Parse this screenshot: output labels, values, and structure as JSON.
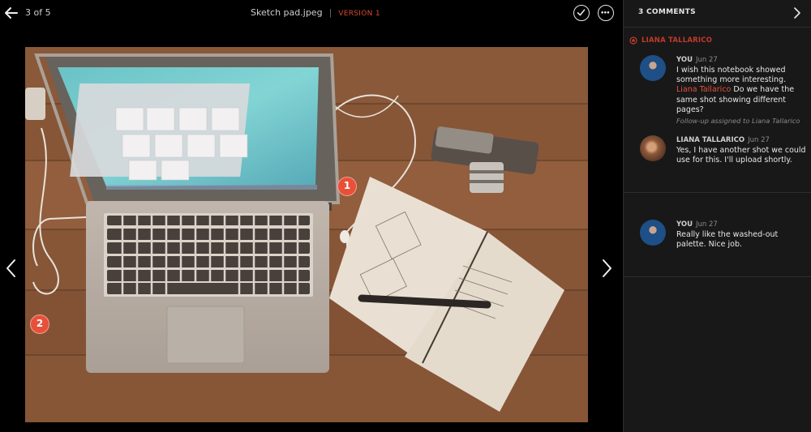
{
  "header": {
    "counter": "3 of 5",
    "filename": "Sketch pad.jpeg",
    "separator": "|",
    "version": "VERSION 1"
  },
  "viewer": {
    "image_description": "Laptop, notebook, pen and camera on wooden desk",
    "pins": [
      {
        "number": "1"
      },
      {
        "number": "2"
      }
    ]
  },
  "sidebar": {
    "title": "3 COMMENTS",
    "thread_label": "LIANA TALLARICO",
    "comments": [
      {
        "author": "YOU",
        "date": "Jun 27",
        "text_before": "I wish this notebook showed something more interesting.",
        "mention": "Liana Tallarico",
        "text_after": "Do we have the same shot showing different pages?",
        "note": "Follow-up assigned to Liana Tallarico"
      },
      {
        "author": "LIANA TALLARICO",
        "date": "Jun 27",
        "text": "Yes, I have another shot we could use for this. I'll upload shortly."
      },
      {
        "author": "YOU",
        "date": "Jun 27",
        "text": "Really like the washed-out palette. Nice job."
      }
    ]
  },
  "colors": {
    "accent": "#d9472f",
    "pin": "#e8503a",
    "sidebar_bg": "#181818"
  }
}
